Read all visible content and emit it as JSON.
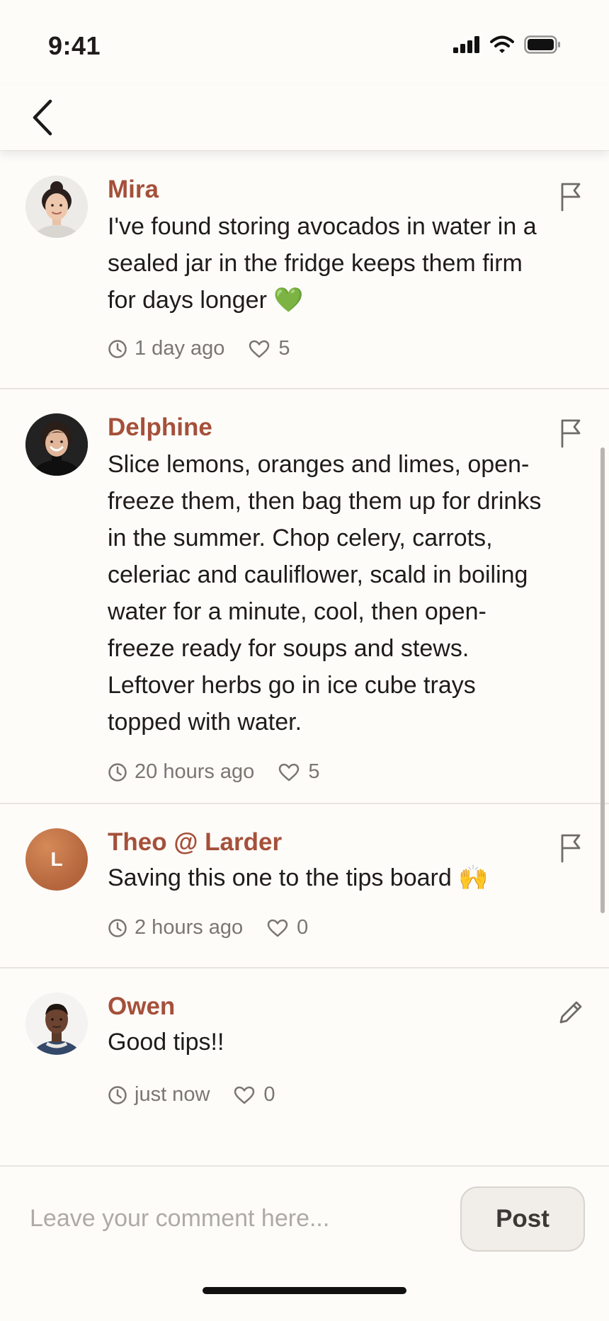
{
  "status_bar": {
    "time": "9:41",
    "icons": [
      "cellular-signal-icon",
      "wifi-icon",
      "battery-icon"
    ]
  },
  "nav": {
    "back_icon": "chevron-left-icon"
  },
  "colors": {
    "background": "#fdfcf9",
    "author_name": "#a5503a",
    "meta_text": "#7b7671",
    "divider": "#e8e5e0",
    "post_button_bg": "#f1eee9"
  },
  "comments": [
    {
      "author": "Mira",
      "text": "I've found storing avocados in water in a sealed jar in the fridge keeps them firm for days longer 💚",
      "time": "1 day ago",
      "likes": "5",
      "action_icon": "flag-icon"
    },
    {
      "author": "Delphine",
      "text": "Slice lemons, oranges and limes, open-freeze them, then bag them up for drinks in the summer. Chop celery, carrots, celeriac and cauliflower, scald in boiling water for a minute, cool, then open-freeze ready for soups and stews. Leftover herbs go in ice cube trays topped with water.",
      "time": "20 hours ago",
      "likes": "5",
      "action_icon": "flag-icon"
    },
    {
      "author": "Theo @ Larder",
      "avatar_letter": "L",
      "text": "Saving this one to the tips board 🙌",
      "time": "2 hours ago",
      "likes": "0",
      "action_icon": "flag-icon"
    },
    {
      "author": "Owen",
      "text": "Good tips!!",
      "time": "just now",
      "likes": "0",
      "action_icon": "pencil-icon"
    }
  ],
  "composer": {
    "placeholder": "Leave your comment here...",
    "value": "",
    "post_label": "Post"
  }
}
